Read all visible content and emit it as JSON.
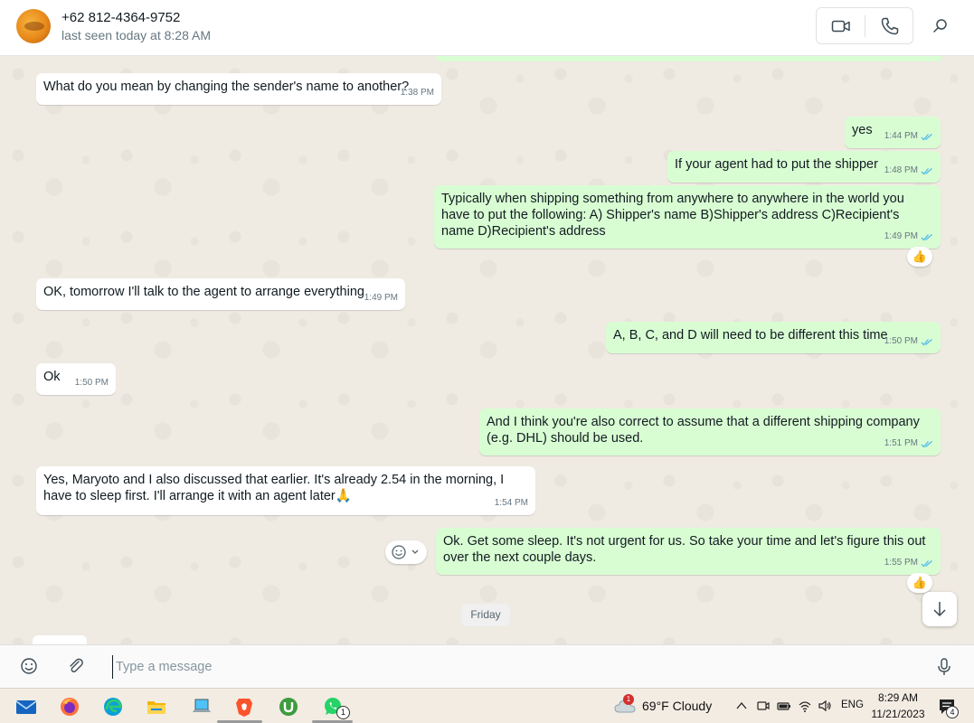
{
  "header": {
    "contact_name": "+62 812-4364-9752",
    "status": "last seen today at 8:28 AM"
  },
  "messages": [
    {
      "direction": "in",
      "text": "What do you mean by changing the sender's name to another?",
      "time": "1:38 PM"
    },
    {
      "direction": "out",
      "text": "yes",
      "time": "1:44 PM"
    },
    {
      "direction": "out",
      "text": "If your agent had to put the shipper",
      "time": "1:48 PM"
    },
    {
      "direction": "out",
      "text": "Typically when shipping something from anywhere to anywhere in the world you have to put the following: A) Shipper's name B)Shipper's address C)Recipient's name D)Recipient's address",
      "time": "1:49 PM",
      "reaction": "👍"
    },
    {
      "direction": "in",
      "text": "OK, tomorrow I'll talk to the agent to arrange everything",
      "time": "1:49 PM"
    },
    {
      "direction": "out",
      "text": "A, B, C, and D will need to be different this time",
      "time": "1:50 PM"
    },
    {
      "direction": "in",
      "text": "Ok",
      "time": "1:50 PM"
    },
    {
      "direction": "out",
      "text": "And I think you're also correct to assume that a different shipping company (e.g. DHL) should be used.",
      "time": "1:51 PM"
    },
    {
      "direction": "in",
      "text": "Yes, Maryoto and I also discussed that earlier.  It's already 2.54 in the morning, I have to sleep first.  I'll arrange it with an agent later🙏",
      "time": "1:54 PM"
    },
    {
      "direction": "out",
      "text": "Ok. Get some sleep. It's not urgent for us. So take your time and let's figure this out over the next couple days.",
      "time": "1:55 PM",
      "reaction": "👍"
    }
  ],
  "date_divider": "Friday",
  "composer": {
    "placeholder": "Type a message"
  },
  "taskbar": {
    "whatsapp_badge": "1",
    "weather_badge": "1",
    "weather": "69°F  Cloudy",
    "language": "ENG",
    "time": "8:29 AM",
    "date": "11/21/2023",
    "notification_count": "4"
  },
  "colors": {
    "outgoing_bubble": "#d9fdd3",
    "incoming_bubble": "#ffffff",
    "chat_background": "#efeae2",
    "read_ticks": "#53bdeb"
  }
}
